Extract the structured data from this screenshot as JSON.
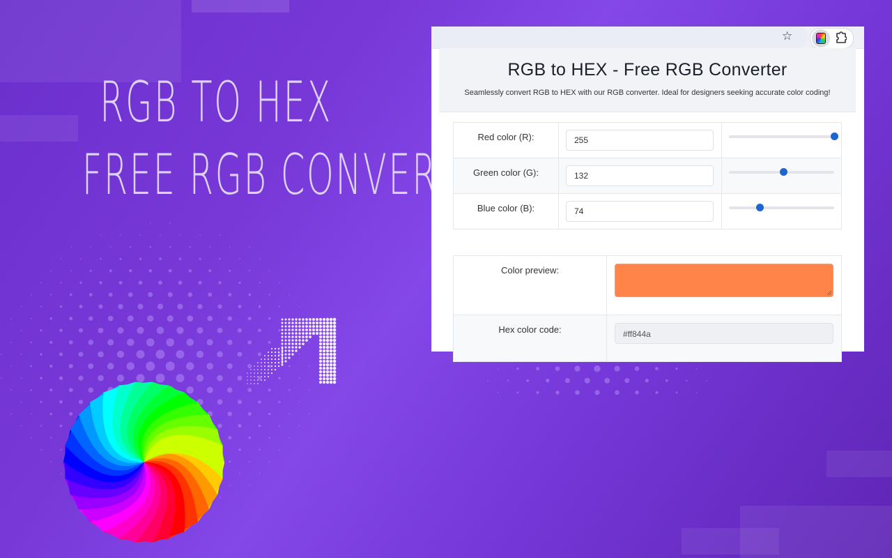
{
  "hero": {
    "line1": "RGB TO HEX",
    "line2": "FREE RGB CONVERTER"
  },
  "decor": {
    "wheel_icon": "color-wheel",
    "arrow_icon": "halftone-arrow-up-right"
  },
  "browser": {
    "toolbar_icons": [
      "star-icon",
      "color-picker-extension-icon",
      "puzzle-extensions-icon"
    ]
  },
  "page": {
    "title": "RGB to HEX - Free RGB Converter",
    "subtitle": "Seamlessly convert RGB to HEX with our RGB converter. Ideal for designers seeking accurate color coding!"
  },
  "channels": [
    {
      "label": "Red color (R):",
      "value": "255",
      "slider_fraction": 1.0
    },
    {
      "label": "Green color (G):",
      "value": "132",
      "slider_fraction": 0.518
    },
    {
      "label": "Blue color (B):",
      "value": "74",
      "slider_fraction": 0.29
    }
  ],
  "result": {
    "preview_label": "Color preview:",
    "preview_color": "#ff844a",
    "hex_label": "Hex color code:",
    "hex_value": "#ff844a"
  },
  "colors": {
    "slider_accent": "#1e66cf",
    "background_purple": "#7838d8"
  }
}
